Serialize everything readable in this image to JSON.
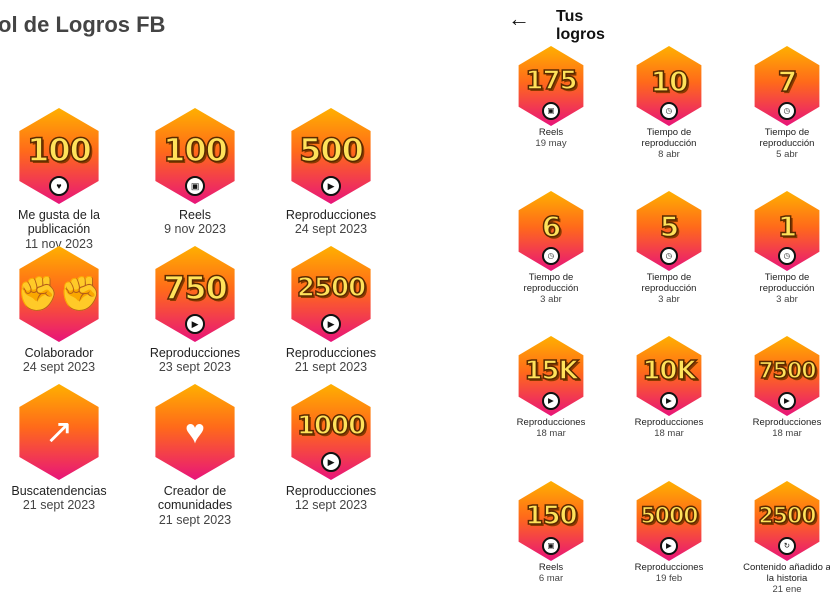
{
  "left": {
    "title": "ol de Logros FB",
    "badges": [
      {
        "value": "100",
        "icon": "heart-icon",
        "glyph": "♥",
        "label": "Me gusta de la publicación",
        "date": "11 nov 2023"
      },
      {
        "value": "100",
        "icon": "reels-icon",
        "glyph": "▣",
        "label": "Reels",
        "date": "9 nov 2023"
      },
      {
        "value": "500",
        "icon": "play-icon",
        "glyph": "▶",
        "label": "Reproducciones",
        "date": "24 sept 2023"
      },
      {
        "value": "",
        "icon": "fists-icon",
        "glyph": "✊✊",
        "label": "Colaborador",
        "date": "24 sept 2023"
      },
      {
        "value": "750",
        "icon": "play-icon",
        "glyph": "▶",
        "label": "Reproducciones",
        "date": "23 sept 2023"
      },
      {
        "value": "2500",
        "icon": "play-icon",
        "glyph": "▶",
        "label": "Reproducciones",
        "date": "21 sept 2023"
      },
      {
        "value": "",
        "icon": "trend-arrow-icon",
        "glyph": "↗",
        "label": "Buscatendencias",
        "date": "21 sept 2023"
      },
      {
        "value": "",
        "icon": "winged-heart-icon",
        "glyph": "♥",
        "label": "Creador de comunidades",
        "date": "21 sept 2023"
      },
      {
        "value": "1000",
        "icon": "play-icon",
        "glyph": "▶",
        "label": "Reproducciones",
        "date": "12 sept 2023"
      }
    ]
  },
  "right": {
    "back_label": "←",
    "title": "Tus logros",
    "badges": [
      {
        "value": "175",
        "icon": "reels-icon",
        "glyph": "▣",
        "label": "Reels",
        "date": "19 may"
      },
      {
        "value": "10",
        "icon": "clock-icon",
        "glyph": "◷",
        "label": "Tiempo de reproducción",
        "date": "8 abr"
      },
      {
        "value": "7",
        "icon": "clock-icon",
        "glyph": "◷",
        "label": "Tiempo de reproducción",
        "date": "5 abr"
      },
      {
        "value": "6",
        "icon": "clock-icon",
        "glyph": "◷",
        "label": "Tiempo de reproducción",
        "date": "3 abr"
      },
      {
        "value": "5",
        "icon": "clock-icon",
        "glyph": "◷",
        "label": "Tiempo de reproducción",
        "date": "3 abr"
      },
      {
        "value": "1",
        "icon": "clock-icon",
        "glyph": "◷",
        "label": "Tiempo de reproducción",
        "date": "3 abr"
      },
      {
        "value": "15K",
        "icon": "play-icon",
        "glyph": "▶",
        "label": "Reproducciones",
        "date": "18 mar"
      },
      {
        "value": "10K",
        "icon": "play-icon",
        "glyph": "▶",
        "label": "Reproducciones",
        "date": "18 mar"
      },
      {
        "value": "7500",
        "icon": "play-icon",
        "glyph": "▶",
        "label": "Reproducciones",
        "date": "18 mar"
      },
      {
        "value": "150",
        "icon": "reels-icon",
        "glyph": "▣",
        "label": "Reels",
        "date": "6 mar"
      },
      {
        "value": "5000",
        "icon": "play-icon",
        "glyph": "▶",
        "label": "Reproducciones",
        "date": "19 feb"
      },
      {
        "value": "2500",
        "icon": "refresh-icon",
        "glyph": "↻",
        "label": "Contenido añadido a la historia",
        "date": "21 ene"
      }
    ]
  },
  "colors": {
    "hex_top": "#ffb000",
    "hex_mid": "#ff6a1a",
    "hex_bottom": "#e8147a",
    "number": "#ffe25a"
  }
}
